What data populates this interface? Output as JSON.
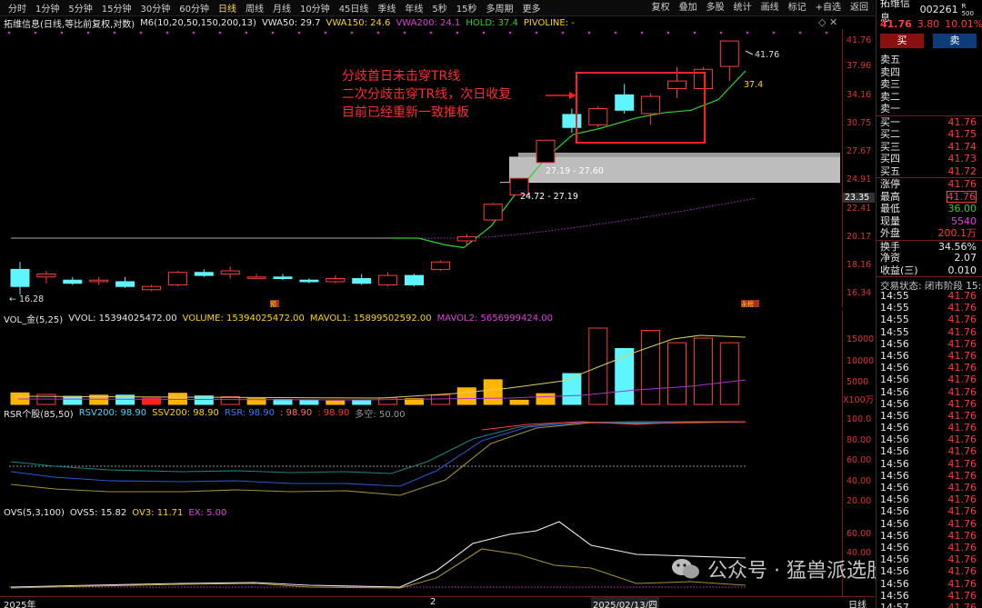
{
  "periods": [
    "分时",
    "1分钟",
    "5分钟",
    "15分钟",
    "30分钟",
    "60分钟",
    "日线",
    "周线",
    "月线",
    "10分钟",
    "45日线",
    "季线",
    "年线",
    "5秒",
    "15秒",
    "多周期",
    "更多"
  ],
  "period_active_index": 6,
  "tools": [
    "复权",
    "叠加",
    "多股",
    "统计",
    "画线",
    "标记",
    "+自选",
    "返回"
  ],
  "main_legend": {
    "title": "拓维信息(日线,等比前复权,对数)",
    "m6": "M6(10,20,50,150,200,13)",
    "vwa50": "VWA50: 29.7",
    "vwa150": "VWA150: 24.6",
    "vwa200": "VWA200: 24.1",
    "hold": "HOLD: 37.4",
    "pivoline": "PIVOLINE: -"
  },
  "price_axis": [
    "41.76",
    "37.96",
    "34.16",
    "30.75",
    "27.67",
    "24.91",
    "22.41",
    "20.17",
    "18.16",
    "16.34"
  ],
  "price_tag": "23.35",
  "annotation": {
    "line1": "分歧首日未击穿TR线",
    "line2": "二次分歧击穿TR线，次日收复",
    "line3": "目前已经重新一致推板"
  },
  "price_labels": {
    "high": "41.76",
    "hold": "37.4",
    "zone_upper": "27.19 - 27.60",
    "zone_lower": "24.72 - 27.19",
    "low_marker": "16.28",
    "left_badge": "周",
    "mark_2": "預",
    "mark_3": "永榜"
  },
  "vol_legend": {
    "name": "VOL_金(5,25)",
    "vvol": "VVOL: 15394025472.00",
    "volume": "VOLUME: 15394025472.00",
    "mavol1": "MAVOL1: 15899502592.00",
    "mavol2": "MAVOL2: 5656999424.00"
  },
  "vol_axis": [
    "15000",
    "10000",
    "5000"
  ],
  "vol_unit": "X100万",
  "rsr_legend": {
    "name": "RSR个股(85,50)",
    "rsv200": "RSV200: 98.90",
    "ssv200": "SSV200: 98.90",
    "rsr": "RSR: 98.90",
    "v1": ": 98.90",
    "v2": ": 98.90",
    "duokong": "多空: 50.00"
  },
  "rsr_axis": [
    "100.0",
    "80.00",
    "60.00",
    "40.00",
    "20.00"
  ],
  "ovs_legend": {
    "name": "OVS(5,3,100)",
    "ovs5": "OVS5: 15.82",
    "ov3": "OV3: 11.71",
    "ex": "EX: 5.00"
  },
  "ovs_axis": [
    "60.00",
    "40.00"
  ],
  "date_axis": {
    "left": "2025年",
    "mid": "2",
    "right": "2025/02/13/四",
    "mode": "日线"
  },
  "watermark": "公众号 · 猛兽派选股",
  "quote": {
    "name": "拓维信息",
    "code": "002261",
    "badge": "R 500",
    "price": "41.76",
    "change": "3.80",
    "pct": "10.01%",
    "buy_label": "买",
    "sell_label": "卖",
    "asks": [
      {
        "label": "卖五",
        "price": "",
        "vol": ""
      },
      {
        "label": "卖四",
        "price": "",
        "vol": ""
      },
      {
        "label": "卖三",
        "price": "",
        "vol": ""
      },
      {
        "label": "卖二",
        "price": "",
        "vol": ""
      },
      {
        "label": "卖一",
        "price": "",
        "vol": ""
      }
    ],
    "bids": [
      {
        "label": "买一",
        "price": "41.76"
      },
      {
        "label": "买二",
        "price": "41.75"
      },
      {
        "label": "买三",
        "price": "41.74"
      },
      {
        "label": "买四",
        "price": "41.73"
      },
      {
        "label": "买五",
        "price": "41.72"
      }
    ],
    "stats": [
      {
        "label": "涨停",
        "value": "41.76",
        "cls": "red"
      },
      {
        "label": "最高",
        "value": "41.76",
        "cls": "red"
      },
      {
        "label": "最低",
        "value": "36.00",
        "cls": "green"
      },
      {
        "label": "现量",
        "value": "5540",
        "cls": "mag"
      },
      {
        "label": "外盘",
        "value": "200.1万",
        "cls": "red"
      },
      {
        "label": "换手",
        "value": "34.56%",
        "cls": "white"
      },
      {
        "label": "净资",
        "value": "2.07",
        "cls": "white"
      },
      {
        "label": "收益(三)",
        "value": "0.010",
        "cls": "white"
      }
    ],
    "trade_status": "交易状态: 闭市阶段 15:00",
    "ticks": [
      {
        "t": "14:55",
        "p": "41.76"
      },
      {
        "t": "14:55",
        "p": "41.76"
      },
      {
        "t": "14:55",
        "p": "41.76"
      },
      {
        "t": "14:55",
        "p": "41.76"
      },
      {
        "t": "14:56",
        "p": "41.76"
      },
      {
        "t": "14:56",
        "p": "41.76"
      },
      {
        "t": "14:56",
        "p": "41.76"
      },
      {
        "t": "14:56",
        "p": "41.76"
      },
      {
        "t": "14:56",
        "p": "41.76"
      },
      {
        "t": "14:56",
        "p": "41.76"
      },
      {
        "t": "14:56",
        "p": "41.76"
      },
      {
        "t": "14:56",
        "p": "41.76"
      },
      {
        "t": "14:56",
        "p": "41.76"
      },
      {
        "t": "14:56",
        "p": "41.76"
      },
      {
        "t": "14:56",
        "p": "41.76"
      },
      {
        "t": "14:56",
        "p": "41.76"
      },
      {
        "t": "14:56",
        "p": "41.76"
      },
      {
        "t": "14:56",
        "p": "41.76"
      },
      {
        "t": "14:56",
        "p": "41.76"
      },
      {
        "t": "14:56",
        "p": "41.76"
      },
      {
        "t": "14:56",
        "p": "41.76"
      },
      {
        "t": "14:56",
        "p": "41.76"
      },
      {
        "t": "14:56",
        "p": "41.76"
      },
      {
        "t": "14:56",
        "p": "41.76"
      },
      {
        "t": "14:56",
        "p": "41.76"
      },
      {
        "t": "14:56",
        "p": "41.76"
      },
      {
        "t": "14:57",
        "p": "41.76"
      }
    ]
  },
  "colors": {
    "up": "#ff3b3b",
    "down": "#5ff5ff",
    "vol_yellow": "#ffb400",
    "ma": "#2ad42a"
  },
  "chart_data": {
    "type": "candlestick",
    "candles": [
      {
        "o": 17.9,
        "c": 16.8,
        "h": 18.4,
        "l": 16.3
      },
      {
        "o": 17.4,
        "c": 17.6,
        "h": 17.8,
        "l": 17.0
      },
      {
        "o": 17.2,
        "c": 17.0,
        "h": 17.4,
        "l": 16.9
      },
      {
        "o": 17.1,
        "c": 17.2,
        "h": 17.4,
        "l": 16.9
      },
      {
        "o": 17.1,
        "c": 16.8,
        "h": 17.4,
        "l": 16.7
      },
      {
        "o": 16.6,
        "c": 16.8,
        "h": 16.9,
        "l": 16.5
      },
      {
        "o": 16.9,
        "c": 17.7,
        "h": 17.8,
        "l": 16.8
      },
      {
        "o": 17.7,
        "c": 17.5,
        "h": 17.9,
        "l": 17.4
      },
      {
        "o": 17.6,
        "c": 17.8,
        "h": 18.1,
        "l": 17.3
      },
      {
        "o": 17.4,
        "c": 17.4,
        "h": 17.6,
        "l": 17.3
      },
      {
        "o": 17.4,
        "c": 17.3,
        "h": 17.6,
        "l": 17.2
      },
      {
        "o": 17.2,
        "c": 17.1,
        "h": 17.3,
        "l": 17.0
      },
      {
        "o": 17.1,
        "c": 17.3,
        "h": 17.5,
        "l": 17.0
      },
      {
        "o": 17.3,
        "c": 17.0,
        "h": 17.6,
        "l": 16.9
      },
      {
        "o": 16.9,
        "c": 17.5,
        "h": 17.7,
        "l": 16.8
      },
      {
        "o": 17.5,
        "c": 16.9,
        "h": 17.6,
        "l": 16.8
      },
      {
        "o": 17.9,
        "c": 18.4,
        "h": 18.5,
        "l": 17.8
      },
      {
        "o": 19.9,
        "c": 20.2,
        "h": 20.4,
        "l": 19.5
      },
      {
        "o": 21.5,
        "c": 22.8,
        "h": 22.9,
        "l": 21.4
      },
      {
        "o": 23.6,
        "c": 25.1,
        "h": 25.1,
        "l": 23.6
      },
      {
        "o": 26.6,
        "c": 28.9,
        "h": 28.9,
        "l": 26.6
      },
      {
        "o": 31.8,
        "c": 30.3,
        "h": 32.5,
        "l": 29.7
      },
      {
        "o": 30.6,
        "c": 32.5,
        "h": 32.8,
        "l": 30.3
      },
      {
        "o": 34.2,
        "c": 32.3,
        "h": 35.6,
        "l": 31.9
      },
      {
        "o": 31.9,
        "c": 34.0,
        "h": 34.4,
        "l": 30.6
      },
      {
        "o": 35.0,
        "c": 36.0,
        "h": 37.9,
        "l": 33.8
      },
      {
        "o": 35.0,
        "c": 37.6,
        "h": 37.9,
        "l": 34.9
      },
      {
        "o": 38.0,
        "c": 41.76,
        "h": 41.76,
        "l": 36.0
      }
    ],
    "volume": [
      3.0,
      2.6,
      2.1,
      2.4,
      2.4,
      1.6,
      2.9,
      2.2,
      2.0,
      1.5,
      1.3,
      1.2,
      0.9,
      1.0,
      1.7,
      1.5,
      2.4,
      4.3,
      6.4,
      1.1,
      2.8,
      8.0,
      19.8,
      14.5,
      19.2,
      16.0,
      17.2,
      16.0,
      16.3
    ],
    "title": "拓维信息(日线,等比前复权,对数)"
  }
}
